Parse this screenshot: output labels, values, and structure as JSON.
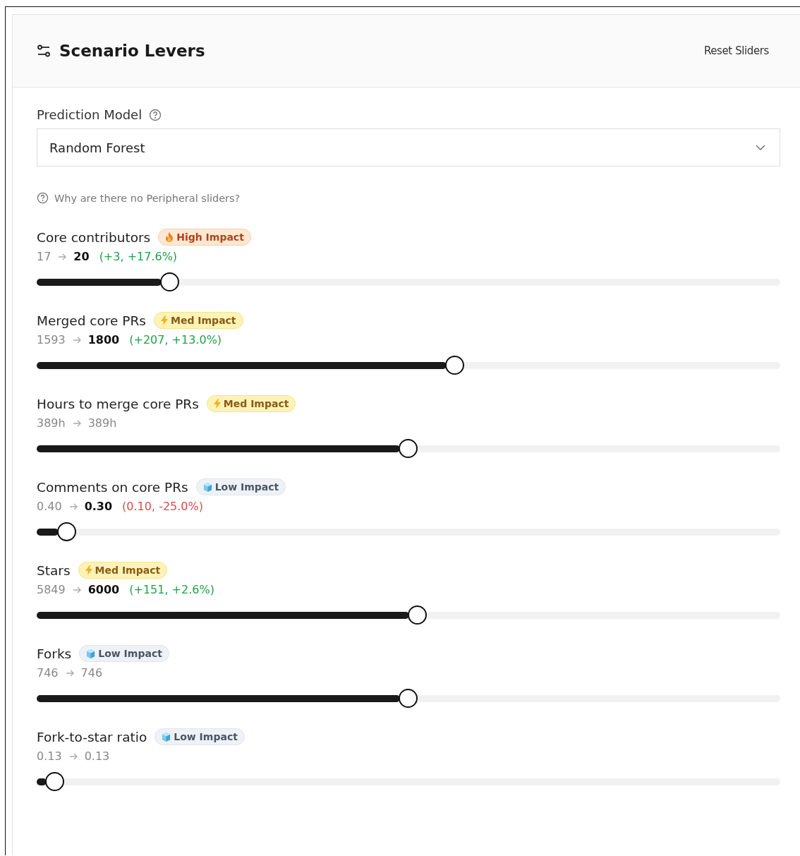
{
  "panel": {
    "title": "Scenario Levers",
    "reset_button": "Reset Sliders"
  },
  "model": {
    "label": "Prediction Model",
    "value": "Random Forest"
  },
  "help_link": "Why are there no Peripheral sliders?",
  "sliders": [
    {
      "name": "Core contributors",
      "impact": {
        "kind": "high",
        "label": "High Impact"
      },
      "from": "17",
      "to": "20",
      "changed": true,
      "delta": {
        "text": "(+3, +17.6%)",
        "color": "#22a04b"
      },
      "level": 0.179
    },
    {
      "name": "Merged core PRs",
      "impact": {
        "kind": "med",
        "label": "Med Impact"
      },
      "from": "1593",
      "to": "1800",
      "changed": true,
      "delta": {
        "text": "(+207, +13.0%)",
        "color": "#22a04b"
      },
      "level": 0.563
    },
    {
      "name": "Hours to merge core PRs",
      "impact": {
        "kind": "med",
        "label": "Med Impact"
      },
      "from": "389h",
      "to": "389h",
      "changed": false,
      "level": 0.5
    },
    {
      "name": "Comments on core PRs",
      "impact": {
        "kind": "low",
        "label": "Low Impact"
      },
      "from": "0.40",
      "to": "0.30",
      "changed": true,
      "delta": {
        "text": "(0.10, -25.0%)",
        "color": "#e04848"
      },
      "level": 0.041
    },
    {
      "name": "Stars",
      "impact": {
        "kind": "med",
        "label": "Med Impact"
      },
      "from": "5849",
      "to": "6000",
      "changed": true,
      "delta": {
        "text": "(+151, +2.6%)",
        "color": "#22a04b"
      },
      "level": 0.512
    },
    {
      "name": "Forks",
      "impact": {
        "kind": "low",
        "label": "Low Impact"
      },
      "from": "746",
      "to": "746",
      "changed": false,
      "level": 0.5
    },
    {
      "name": "Fork-to-star ratio",
      "impact": {
        "kind": "low",
        "label": "Low Impact"
      },
      "from": "0.13",
      "to": "0.13",
      "changed": false,
      "level": 0.025
    }
  ]
}
